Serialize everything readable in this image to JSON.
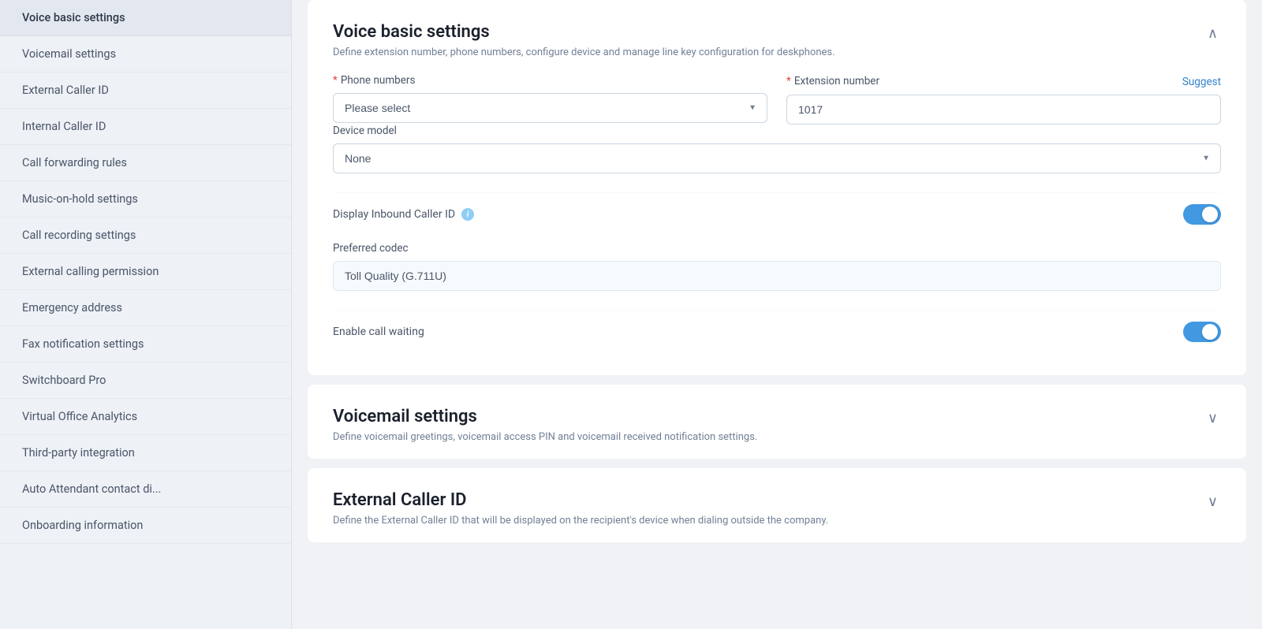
{
  "sidebar": {
    "items": [
      {
        "id": "voice-basic",
        "label": "Voice basic settings",
        "active": true
      },
      {
        "id": "voicemail",
        "label": "Voicemail settings",
        "active": false
      },
      {
        "id": "external-caller-id",
        "label": "External Caller ID",
        "active": false
      },
      {
        "id": "internal-caller-id",
        "label": "Internal Caller ID",
        "active": false
      },
      {
        "id": "call-forwarding",
        "label": "Call forwarding rules",
        "active": false
      },
      {
        "id": "music-on-hold",
        "label": "Music-on-hold settings",
        "active": false
      },
      {
        "id": "call-recording",
        "label": "Call recording settings",
        "active": false
      },
      {
        "id": "external-calling",
        "label": "External calling permission",
        "active": false
      },
      {
        "id": "emergency-address",
        "label": "Emergency address",
        "active": false
      },
      {
        "id": "fax-notification",
        "label": "Fax notification settings",
        "active": false
      },
      {
        "id": "switchboard-pro",
        "label": "Switchboard Pro",
        "active": false
      },
      {
        "id": "virtual-office",
        "label": "Virtual Office Analytics",
        "active": false
      },
      {
        "id": "third-party",
        "label": "Third-party integration",
        "active": false
      },
      {
        "id": "auto-attendant",
        "label": "Auto Attendant contact di...",
        "active": false
      },
      {
        "id": "onboarding",
        "label": "Onboarding information",
        "active": false
      }
    ]
  },
  "sections": {
    "voice_basic": {
      "title": "Voice basic settings",
      "subtitle": "Define extension number, phone numbers, configure device and manage line key configuration for deskphones.",
      "expanded": true,
      "phone_numbers_label": "Phone numbers",
      "phone_numbers_placeholder": "Please select",
      "extension_number_label": "Extension number",
      "extension_number_value": "1017",
      "suggest_label": "Suggest",
      "device_model_label": "Device model",
      "device_model_value": "None",
      "display_inbound_label": "Display Inbound Caller ID",
      "display_inbound_enabled": true,
      "preferred_codec_label": "Preferred codec",
      "preferred_codec_value": "Toll Quality (G.711U)",
      "enable_call_waiting_label": "Enable call waiting",
      "enable_call_waiting_enabled": true
    },
    "voicemail": {
      "title": "Voicemail settings",
      "subtitle": "Define voicemail greetings, voicemail access PIN and voicemail received notification settings.",
      "expanded": false
    },
    "external_caller_id": {
      "title": "External Caller ID",
      "subtitle": "Define the External Caller ID that will be displayed on the recipient's device when dialing outside the company.",
      "expanded": false
    }
  },
  "icons": {
    "chevron_up": "∧",
    "chevron_down": "∨",
    "info": "i"
  }
}
